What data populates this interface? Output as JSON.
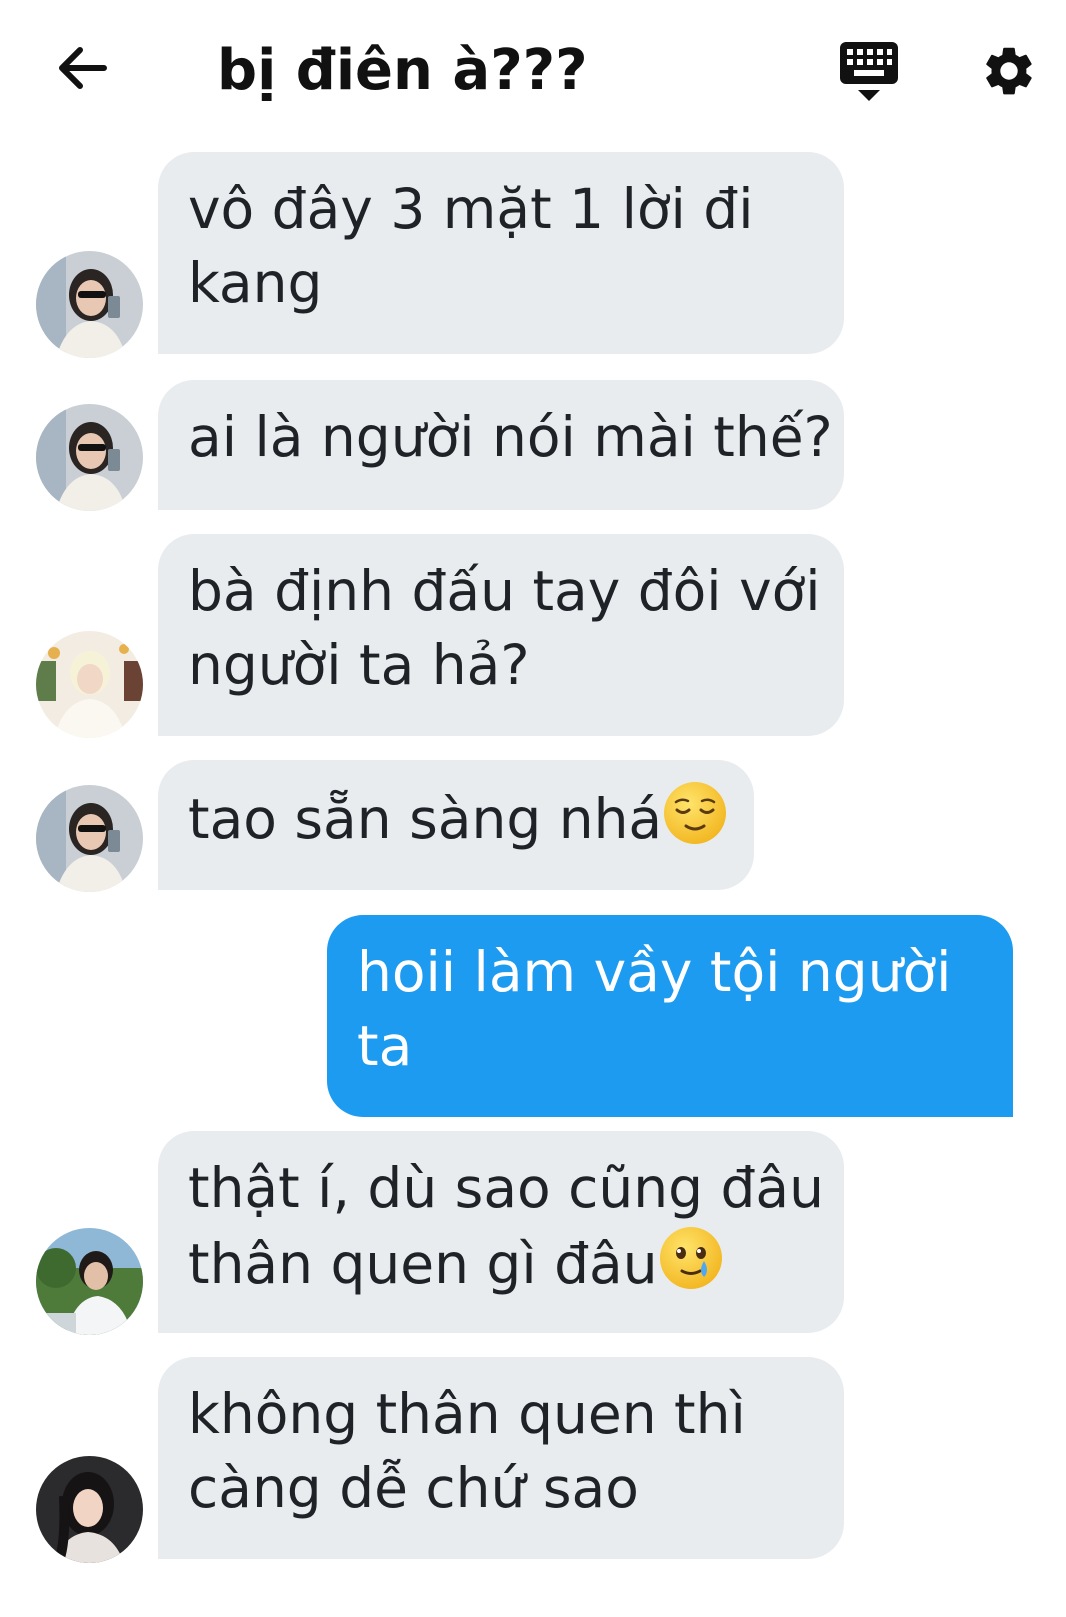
{
  "header": {
    "title": "bị điên à???",
    "back_icon": "arrow-left-icon",
    "keyboard_icon": "keyboard-icon",
    "settings_icon": "gear-icon"
  },
  "messages": [
    {
      "direction": "incoming",
      "lines": [
        "vô đây 3 mặt 1 lời đi",
        "kang"
      ],
      "avatar": "avatar-girl-sunglasses"
    },
    {
      "direction": "incoming",
      "lines": [
        "ai là người nói mài thế?"
      ],
      "avatar": "avatar-girl-sunglasses"
    },
    {
      "direction": "incoming",
      "lines": [
        "bà định đấu tay đôi với",
        "người ta hả?"
      ],
      "avatar": "avatar-blonde-boy"
    },
    {
      "direction": "incoming",
      "lines": [
        "tao sẵn sàng nhá"
      ],
      "emoji": "relieved-face-emoji",
      "avatar": "avatar-girl-sunglasses"
    },
    {
      "direction": "outgoing",
      "lines": [
        "hoii làm vầy tội người",
        "ta"
      ]
    },
    {
      "direction": "incoming",
      "lines": [
        "thật í, dù sao cũng đâu",
        "thân quen gì đâu"
      ],
      "emoji": "face-holding-back-tears-emoji",
      "avatar": "avatar-boy-outdoors"
    },
    {
      "direction": "incoming",
      "lines": [
        "không thân quen thì",
        "càng dễ chứ sao"
      ],
      "avatar": "avatar-girl-dark-hair"
    }
  ],
  "colors": {
    "incoming_bubble": "#e9ecef",
    "outgoing_bubble": "#1d9bf0",
    "text": "#1f2328"
  }
}
